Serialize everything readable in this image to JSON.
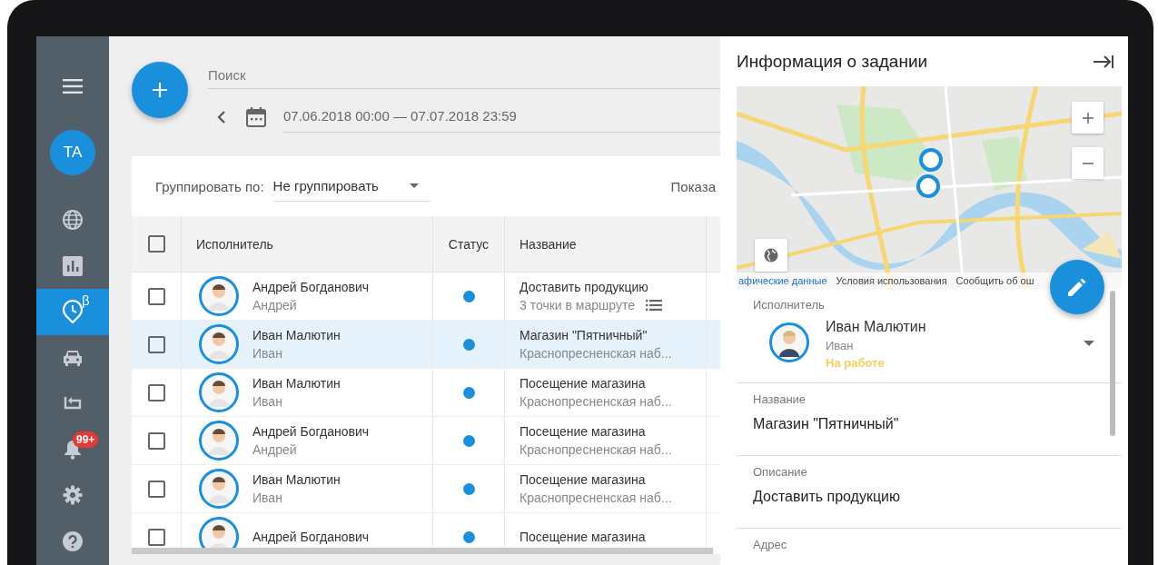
{
  "sidebar": {
    "avatar": {
      "initials": "TA"
    },
    "items": [
      {
        "kind": "globe",
        "selected": false
      },
      {
        "kind": "chart",
        "selected": false
      },
      {
        "kind": "clock",
        "selected": true,
        "superscript": "β"
      },
      {
        "kind": "car",
        "selected": false
      },
      {
        "kind": "route",
        "selected": false
      },
      {
        "kind": "bell",
        "selected": false,
        "badge": "99+"
      },
      {
        "kind": "gear",
        "selected": false
      },
      {
        "kind": "help",
        "selected": false
      }
    ]
  },
  "search": {
    "placeholder": "Поиск"
  },
  "date_range": "07.06.2018 00:00 — 07.07.2018 23:59",
  "toolbar": {
    "group_label": "Группировать по:",
    "group_value": "Не группировать",
    "show_label": "Показа"
  },
  "table": {
    "select_all_checked": false,
    "columns": [
      "Исполнитель",
      "Статус",
      "Название"
    ],
    "rows": [
      {
        "name": "Андрей Богданович",
        "short": "Андрей",
        "title": "Доставить продукцию",
        "subtitle": "3 точки в маршруте",
        "route_list": true,
        "checked": false,
        "selected": false
      },
      {
        "name": "Иван Малютин",
        "short": "Иван",
        "title": "Магазин \"Пятничный\"",
        "subtitle": "Краснопресненская наб...",
        "checked": false,
        "selected": true
      },
      {
        "name": "Иван Малютин",
        "short": "Иван",
        "title": "Посещение магазина",
        "subtitle": "Краснопресненская наб...",
        "checked": false,
        "selected": false
      },
      {
        "name": "Андрей Богданович",
        "short": "Андрей",
        "title": "Посещение магазина",
        "subtitle": "Краснопресненская наб...",
        "checked": false,
        "selected": false
      },
      {
        "name": "Иван Малютин",
        "short": "Иван",
        "title": "Посещение магазина",
        "subtitle": "Краснопресненская наб...",
        "checked": false,
        "selected": false
      },
      {
        "name": "Андрей Богданович",
        "title": "Посещение магазина",
        "checked": false,
        "selected": false
      }
    ]
  },
  "panel": {
    "title": "Информация о задании",
    "map": {
      "attribution": [
        "афические данные",
        "Условия использования",
        "Сообщить об ош"
      ]
    },
    "executor": {
      "label": "Исполнитель",
      "name": "Иван Малютин",
      "short": "Иван",
      "status": "На работе"
    },
    "fields": [
      {
        "label": "Название",
        "value": "Магазин \"Пятничный\""
      },
      {
        "label": "Описание",
        "value": "Доставить продукцию"
      },
      {
        "label": "Адрес"
      }
    ]
  }
}
